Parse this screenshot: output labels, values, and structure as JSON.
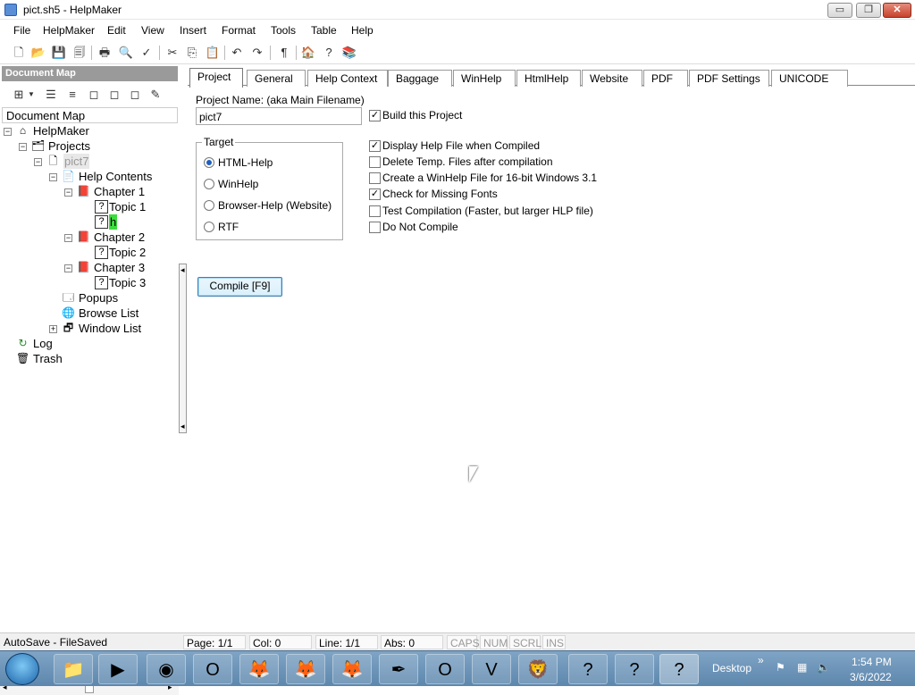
{
  "window": {
    "title": "pict.sh5 - HelpMaker",
    "min": "▭",
    "max": "❐",
    "close": "✕"
  },
  "menu": [
    "File",
    "HelpMaker",
    "Edit",
    "View",
    "Insert",
    "Format",
    "Tools",
    "Table",
    "Help"
  ],
  "docmap": {
    "header": "Document Map",
    "label": "Document Map",
    "tree": {
      "root": "HelpMaker",
      "projects": "Projects",
      "project": "pict7",
      "help_contents": "Help Contents",
      "chapter1": "Chapter 1",
      "topic1": "Topic 1",
      "new_topic": "h",
      "chapter2": "Chapter 2",
      "topic2": "Topic 2",
      "chapter3": "Chapter 3",
      "topic3": "Topic 3",
      "popups": "Popups",
      "browse_list": "Browse List",
      "window_list": "Window List",
      "log": "Log",
      "trash": "Trash"
    }
  },
  "tabs": [
    "Project",
    "General",
    "Help Context",
    "Baggage",
    "WinHelp",
    "HtmlHelp",
    "Website",
    "PDF",
    "PDF Settings",
    "UNICODE"
  ],
  "project": {
    "name_label": "Project Name: (aka Main Filename)",
    "name_value": "pict7",
    "build_label": "Build this Project",
    "build_checked": true,
    "target_title": "Target",
    "targets": [
      {
        "label": "HTML-Help",
        "selected": true
      },
      {
        "label": "WinHelp",
        "selected": false
      },
      {
        "label": "Browser-Help (Website)",
        "selected": false
      },
      {
        "label": "RTF",
        "selected": false
      }
    ],
    "options": [
      {
        "label": "Display Help File when Compiled",
        "checked": true
      },
      {
        "label": "Delete Temp. Files after compilation",
        "checked": false
      },
      {
        "label": "Create a WinHelp File for 16-bit Windows 3.1",
        "checked": false
      },
      {
        "label": "Check for Missing Fonts",
        "checked": true
      },
      {
        "label": "Test Compilation (Faster, but larger HLP file)",
        "checked": false
      },
      {
        "label": "Do Not Compile",
        "checked": false
      }
    ],
    "compile_button": "Compile [F9]"
  },
  "status": {
    "autosave": "AutoSave - FileSaved",
    "page": "Page: 1/1",
    "col": "Col: 0",
    "line": "Line: 1/1",
    "abs": "Abs: 0",
    "caps": "CAPS",
    "num": "NUM",
    "scrl": "SCRL",
    "ins": "INS"
  },
  "taskbar": {
    "desktop": "Desktop",
    "chevron": "»",
    "time": "1:54 PM",
    "date": "3/6/2022"
  }
}
